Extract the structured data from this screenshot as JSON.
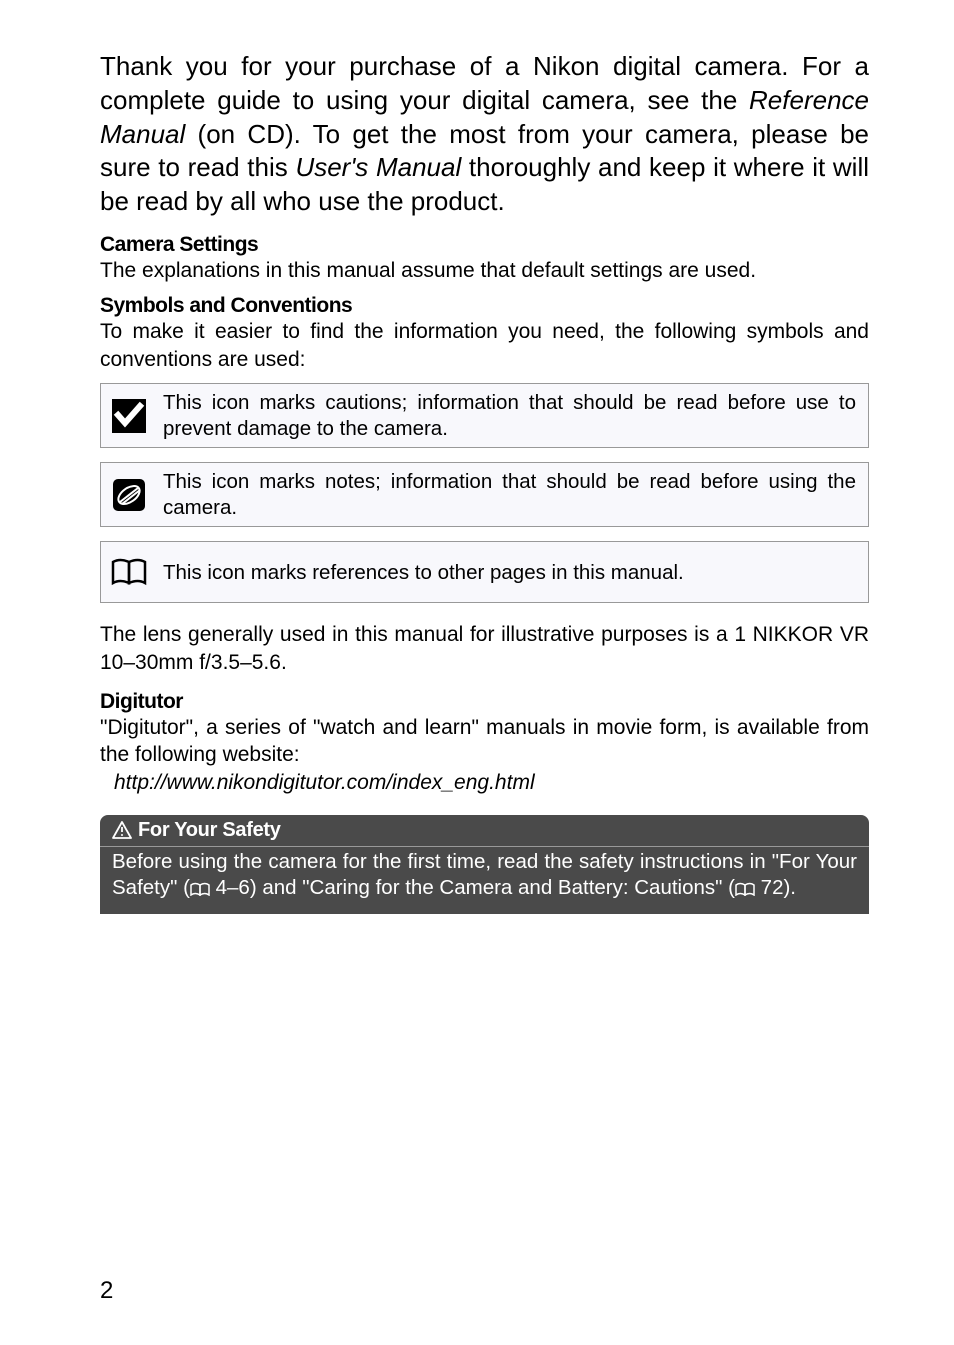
{
  "intro": {
    "part1": "Thank you for your purchase of a Nikon digital camera. For a complete guide to using your digital camera, see the ",
    "ref_manual": "Reference Manual",
    "part2": " (on CD). To get the most from your camera, please be sure to read this ",
    "users_manual": "User's Manual",
    "part3": " thoroughly and keep it where it will be read by all who use the product."
  },
  "camera_settings": {
    "heading": "Camera Settings",
    "body": "The explanations in this manual assume that default settings are used."
  },
  "symbols": {
    "heading": "Symbols and Conventions",
    "body": "To make it easier to find the information you need, the following symbols and conventions are used:"
  },
  "icon_boxes": [
    {
      "icon": "caution-checkmark",
      "text": "This icon marks cautions; information that should be read before use to prevent damage to the camera."
    },
    {
      "icon": "note-pencil",
      "text": "This icon marks notes; information that should be read before using the camera."
    },
    {
      "icon": "book-reference",
      "text": "This icon marks references to other pages in this manual."
    }
  ],
  "lens_text": "The lens generally used in this manual for illustrative purposes is a 1 NIKKOR VR 10–30mm f/3.5–5.6.",
  "digitutor": {
    "heading": "Digitutor",
    "body": "\"Digitutor\", a series of \"watch and learn\" manuals in movie form, is available from the following website:",
    "url": "http://www.nikondigitutor.com/index_eng.html"
  },
  "safety": {
    "header": "For Your Safety",
    "body_part1": "Before using the camera for the first time, read the safety instructions in \"For Your Safety\" (",
    "body_ref1": " 4–6) and \"Caring for the Camera and Battery: Cautions\" (",
    "body_ref2": " 72)."
  },
  "page_number": "2"
}
